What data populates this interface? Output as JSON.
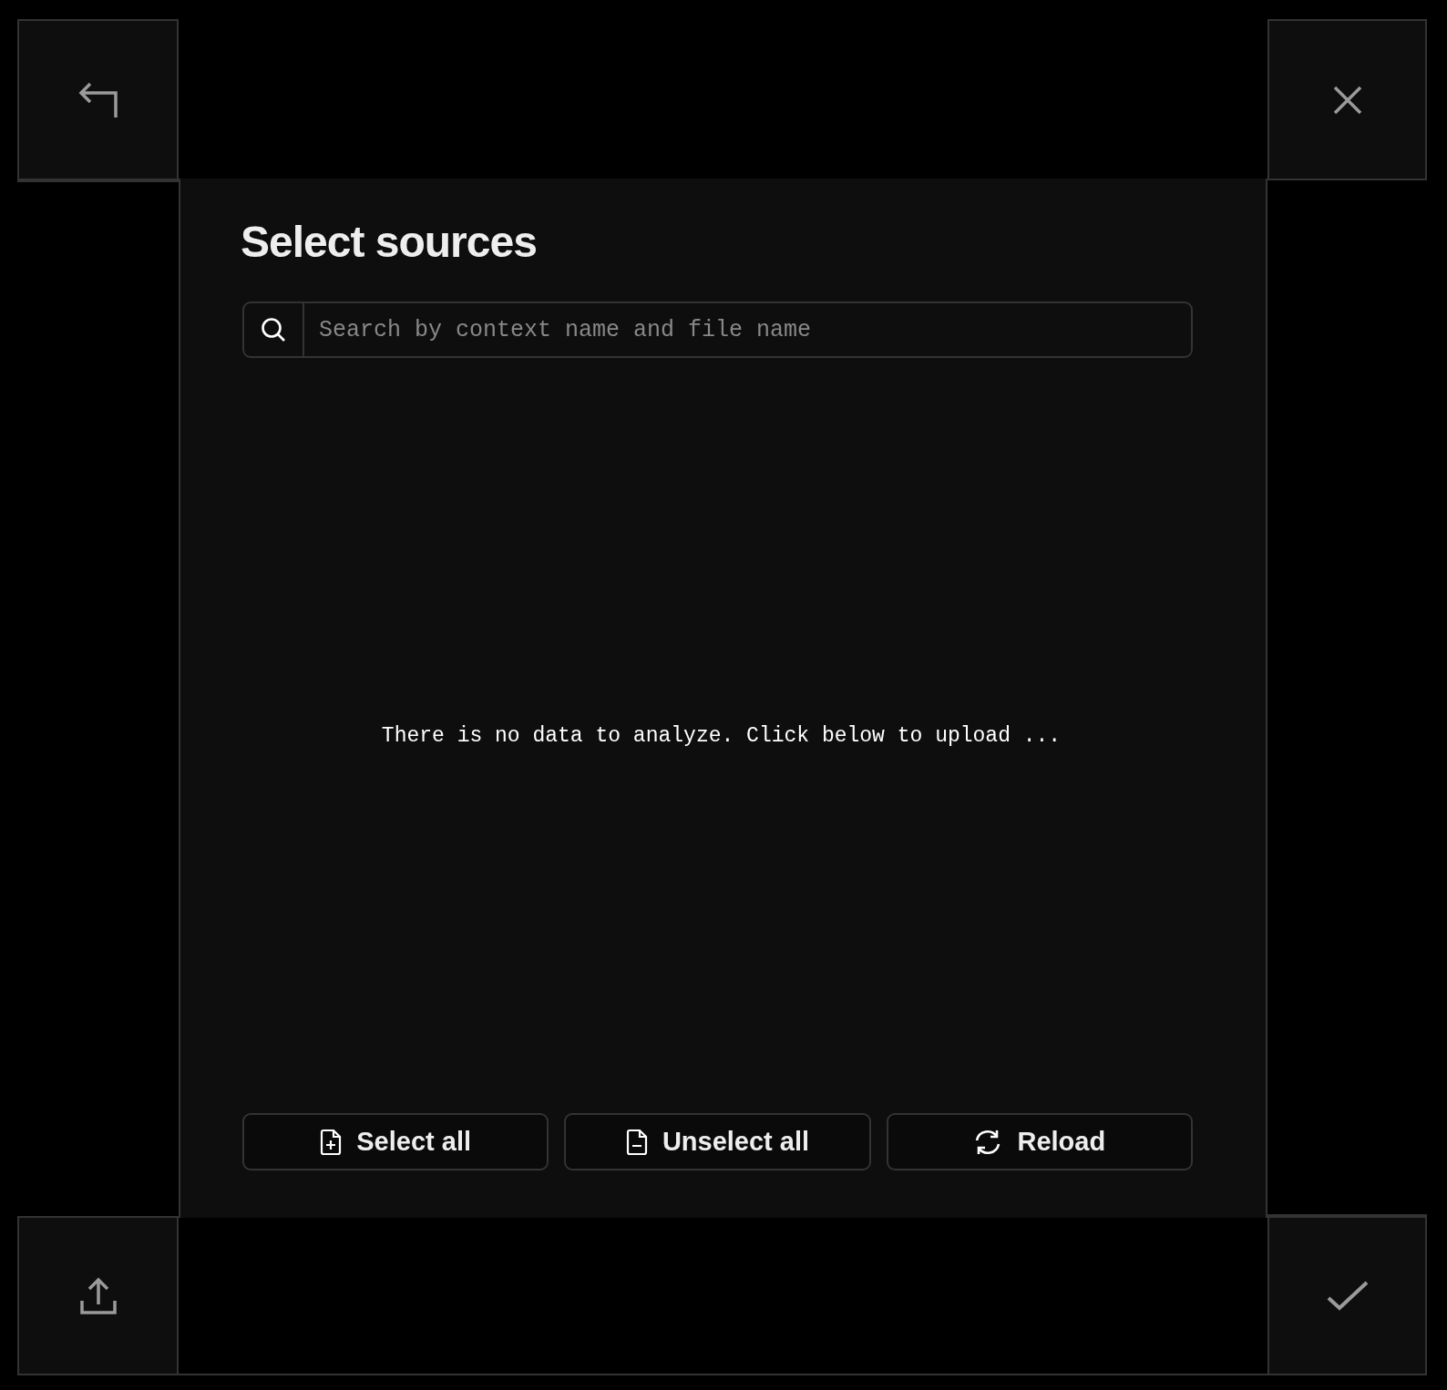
{
  "title": "Select sources",
  "search": {
    "placeholder": "Search by context name and file name"
  },
  "empty_message": "There is no data to analyze. Click below to upload ...",
  "buttons": [
    {
      "kind": "add",
      "label": "Select all"
    },
    {
      "kind": "remove",
      "label": "Unselect all"
    },
    {
      "kind": "reload",
      "label": "Reload"
    }
  ]
}
